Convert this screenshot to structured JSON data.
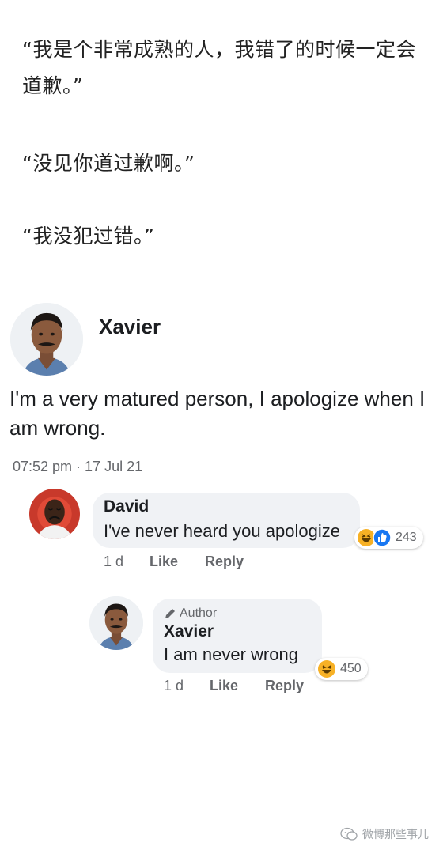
{
  "caption": {
    "line1": "“我是个非常成熟的人，我错了的时候一定会道歉。”",
    "line2": "“没见你道过歉啊。”",
    "line3": "“我没犯过错。”"
  },
  "post": {
    "author": "Xavier",
    "text": "I'm a very matured person, I apologize when I am wrong.",
    "timestamp": "07:52 pm · 17 Jul 21",
    "avatar_icon": "man-mustache-avatar-icon"
  },
  "comments": [
    {
      "author": "David",
      "text": "I've never heard you apologize",
      "reaction_icons": [
        "haha-icon",
        "like-icon"
      ],
      "reaction_count": "243",
      "time": "1 d",
      "like_label": "Like",
      "reply_label": "Reply",
      "avatar_icon": "crying-man-avatar-icon"
    },
    {
      "badge": "Author",
      "badge_icon": "pencil-icon",
      "author": "Xavier",
      "text": "I am never wrong",
      "reaction_icons": [
        "haha-icon"
      ],
      "reaction_count": "450",
      "time": "1 d",
      "like_label": "Like",
      "reply_label": "Reply",
      "avatar_icon": "man-mustache-avatar-icon"
    }
  ],
  "watermark": {
    "text": "微博那些事儿",
    "icon": "wechat-icon"
  },
  "colors": {
    "bubble": "#f0f2f5",
    "secondary_text": "#65676b",
    "like_blue": "#1877f2",
    "haha_yellow": "#f7b125"
  }
}
